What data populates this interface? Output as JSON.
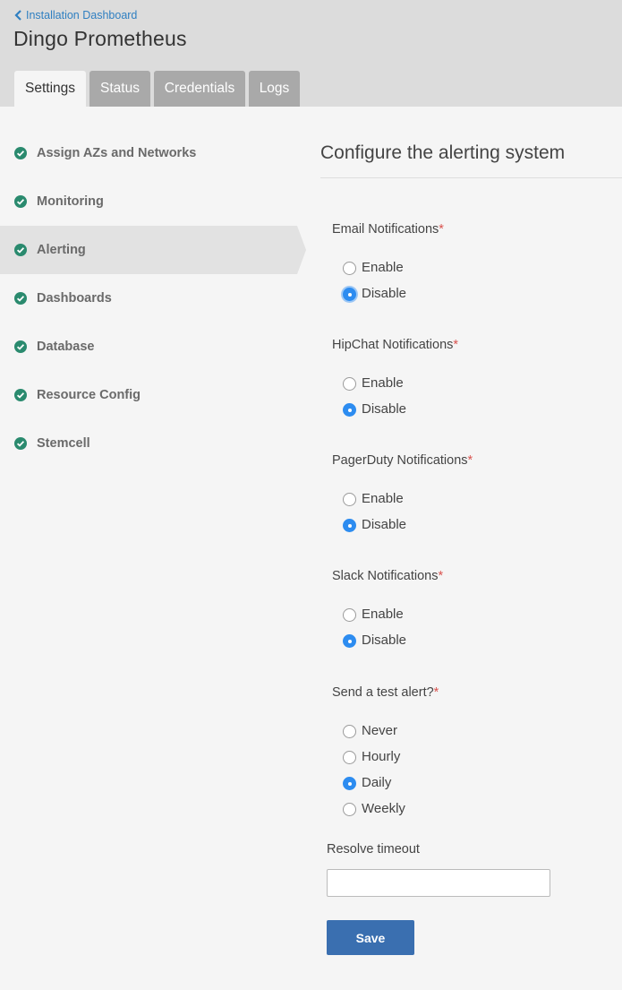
{
  "header": {
    "back_link": "Installation Dashboard",
    "title": "Dingo Prometheus",
    "tabs": [
      {
        "label": "Settings",
        "active": true
      },
      {
        "label": "Status",
        "active": false
      },
      {
        "label": "Credentials",
        "active": false
      },
      {
        "label": "Logs",
        "active": false
      }
    ]
  },
  "sidebar": {
    "items": [
      {
        "label": "Assign AZs and Networks",
        "icon": "check-circle-icon",
        "active": false
      },
      {
        "label": "Monitoring",
        "icon": "check-circle-icon",
        "active": false
      },
      {
        "label": "Alerting",
        "icon": "check-circle-icon",
        "active": true
      },
      {
        "label": "Dashboards",
        "icon": "check-circle-icon",
        "active": false
      },
      {
        "label": "Database",
        "icon": "check-circle-icon",
        "active": false
      },
      {
        "label": "Resource Config",
        "icon": "check-circle-icon",
        "active": false
      },
      {
        "label": "Stemcell",
        "icon": "check-circle-icon",
        "active": false
      }
    ]
  },
  "main": {
    "title": "Configure the alerting system",
    "groups": [
      {
        "label": "Email Notifications",
        "required_mark": "*",
        "options": [
          "Enable",
          "Disable"
        ],
        "selected": "Disable"
      },
      {
        "label": "HipChat Notifications",
        "required_mark": "*",
        "options": [
          "Enable",
          "Disable"
        ],
        "selected": "Disable"
      },
      {
        "label": "PagerDuty Notifications",
        "required_mark": "*",
        "options": [
          "Enable",
          "Disable"
        ],
        "selected": "Disable"
      },
      {
        "label": "Slack Notifications",
        "required_mark": "*",
        "options": [
          "Enable",
          "Disable"
        ],
        "selected": "Disable"
      },
      {
        "label": "Send a test alert?",
        "required_mark": "*",
        "options": [
          "Never",
          "Hourly",
          "Daily",
          "Weekly"
        ],
        "selected": "Daily"
      }
    ],
    "resolve_timeout": {
      "label": "Resolve timeout",
      "value": ""
    },
    "save_label": "Save"
  },
  "colors": {
    "accent": "#2d8cf0",
    "link": "#2f7fc1",
    "check": "#2a8a6e",
    "save_button": "#3a6fb0",
    "required": "#d9534f"
  }
}
